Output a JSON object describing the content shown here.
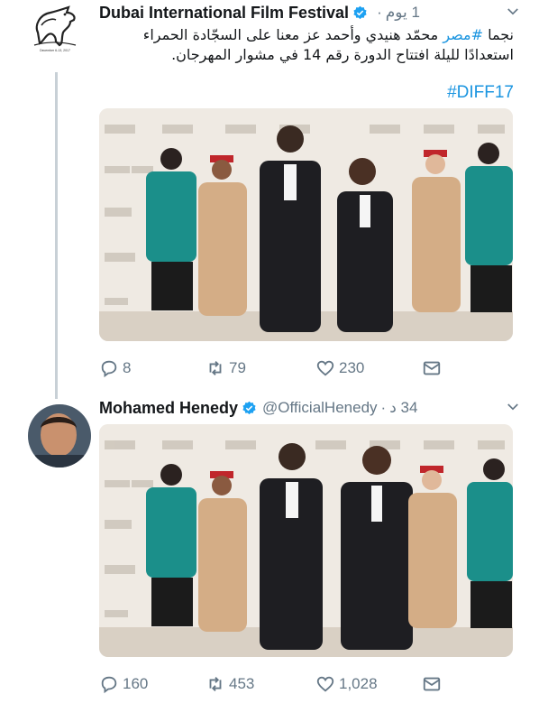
{
  "tweets": [
    {
      "author": "Dubai International Film Festival",
      "handle": "",
      "time": "1 يوم",
      "logo_caption": "December 6-13, 2017",
      "text_hashtag": "#مصر",
      "text_line1": "نجما",
      "text_line1b": "محمّد هنيدي وأحمد عز معنا على السجّادة الحمراء",
      "text_line2": "استعدادًا لليلة افتتاح الدورة رقم 14 في مشوار المهرجان.",
      "hashtag": "#DIFF17",
      "stats": {
        "replies": "8",
        "retweets": "79",
        "likes": "230"
      }
    },
    {
      "author": "Mohamed Henedy",
      "handle": "@OfficialHenedy",
      "time": "34 د",
      "stats": {
        "replies": "160",
        "retweets": "453",
        "likes": "1,028"
      }
    }
  ],
  "icons": [
    "verified-badge-icon",
    "chevron-down-icon",
    "reply-icon",
    "retweet-icon",
    "like-icon",
    "direct-message-icon"
  ],
  "colors": {
    "accent": "#1b95e0",
    "muted": "#657786",
    "thread_line": "#c8d0d6"
  }
}
